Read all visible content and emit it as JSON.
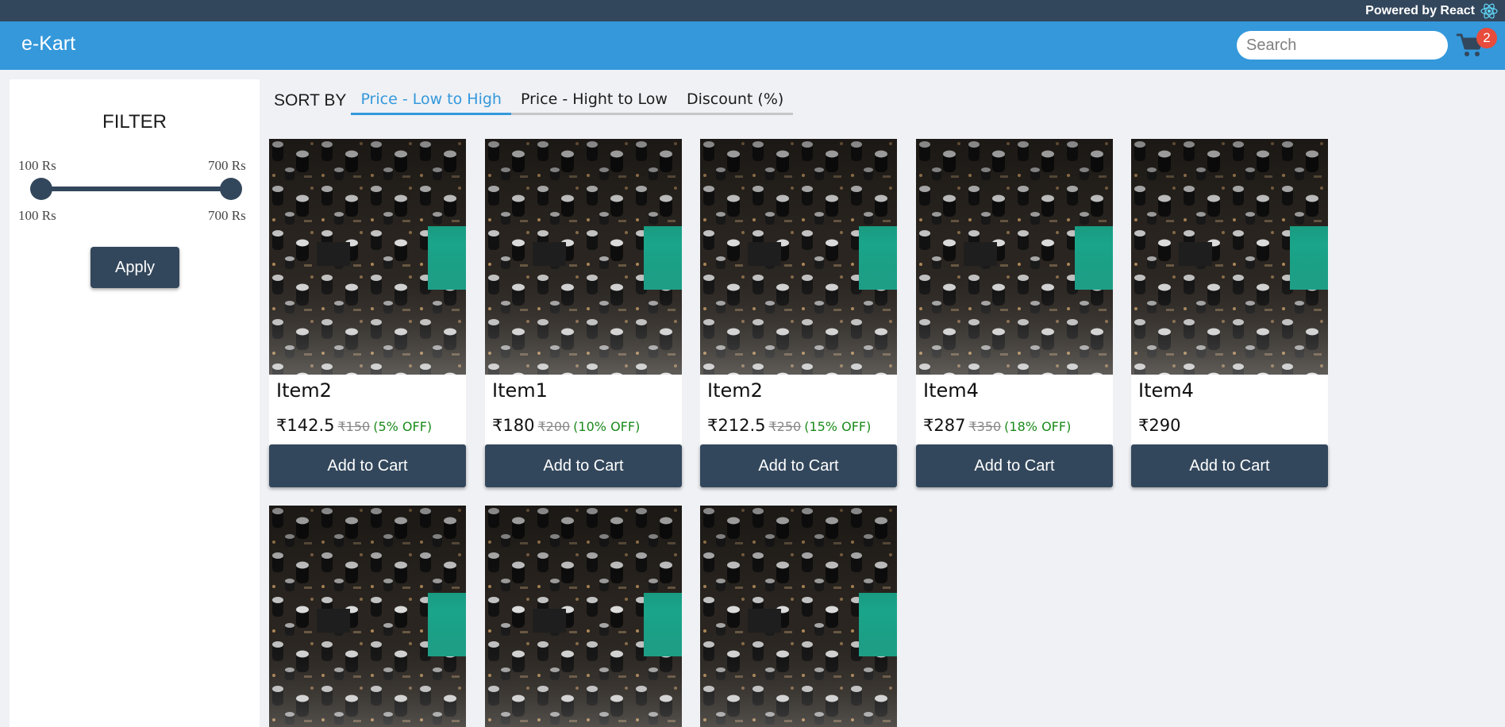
{
  "topbar": {
    "powered_by": "Powered by React",
    "icon": "react-icon"
  },
  "header": {
    "brand": "e-Kart",
    "search_placeholder": "Search",
    "cart_icon": "cart-icon",
    "cart_count": "2"
  },
  "filter": {
    "title": "FILTER",
    "min_label_top": "100 Rs",
    "max_label_top": "700 Rs",
    "min_label_bottom": "100 Rs",
    "max_label_bottom": "700 Rs",
    "apply_label": "Apply"
  },
  "sort": {
    "label": "SORT BY",
    "options": [
      {
        "label": "Price - Low to High",
        "active": true
      },
      {
        "label": "Price - Hight to Low",
        "active": false
      },
      {
        "label": "Discount (%)",
        "active": false
      }
    ]
  },
  "products": [
    {
      "name": "Item2",
      "price": "₹142.5",
      "old_price": "₹150",
      "discount": "(5% OFF)",
      "button": "Add to Cart"
    },
    {
      "name": "Item1",
      "price": "₹180",
      "old_price": "₹200",
      "discount": "(10% OFF)",
      "button": "Add to Cart"
    },
    {
      "name": "Item2",
      "price": "₹212.5",
      "old_price": "₹250",
      "discount": "(15% OFF)",
      "button": "Add to Cart"
    },
    {
      "name": "Item4",
      "price": "₹287",
      "old_price": "₹350",
      "discount": "(18% OFF)",
      "button": "Add to Cart"
    },
    {
      "name": "Item4",
      "price": "₹290",
      "old_price": "",
      "discount": "",
      "button": "Add to Cart"
    }
  ],
  "colors": {
    "header": "#3498db",
    "top_strip": "#33475c",
    "button": "#33475c",
    "badge": "#e74c3c",
    "discount": "#1a8a1a"
  }
}
